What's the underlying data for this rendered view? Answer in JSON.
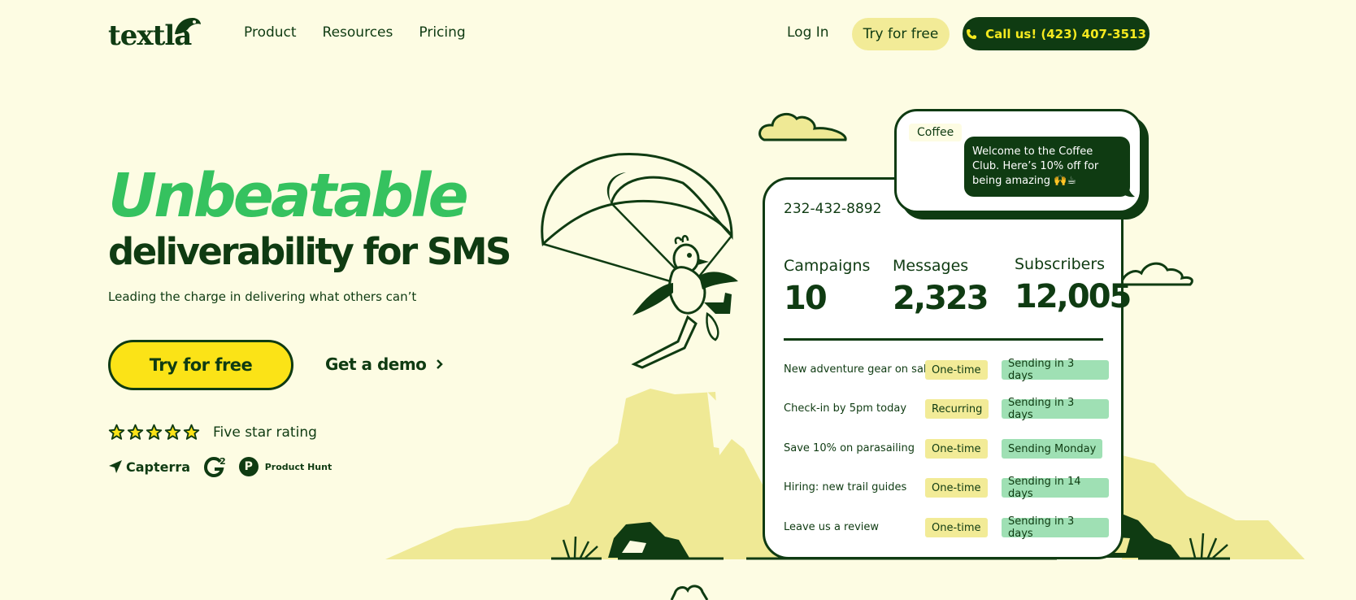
{
  "nav": {
    "logo_text": "textla",
    "links": [
      "Product",
      "Resources",
      "Pricing"
    ],
    "login": "Log In",
    "try_free": "Try for free",
    "call": "Call us! (423) 407-3513"
  },
  "hero": {
    "headline_1": "Unbeatable",
    "headline_2": "deliverability for SMS",
    "subtitle": "Leading the charge in delivering what others can’t",
    "cta_primary": "Try for free",
    "cta_secondary": "Get a demo",
    "rating_label": "Five star rating",
    "rating_stars": 5,
    "badges": {
      "capterra": "Capterra",
      "g2": "2",
      "producthunt_icon": "P",
      "producthunt": "Product Hunt"
    }
  },
  "message_card": {
    "sender": "Coffee",
    "message": "Welcome to the Coffee Club. Here’s 10% off for being amazing 🙌☕"
  },
  "dashboard": {
    "phone_number": "232-432-8892",
    "stats": [
      {
        "label": "Campaigns",
        "value": "10"
      },
      {
        "label": "Messages",
        "value": "2,323"
      },
      {
        "label": "Subscribers",
        "value": "12,005"
      }
    ],
    "campaigns": [
      {
        "name": "New adventure gear on sale",
        "type": "One-time",
        "status": "Sending in 3 days"
      },
      {
        "name": "Check-in by 5pm today",
        "type": "Recurring",
        "status": "Sending in 3 days"
      },
      {
        "name": "Save 10% on parasailing",
        "type": "One-time",
        "status": "Sending Monday"
      },
      {
        "name": "Hiring: new trail guides",
        "type": "One-time",
        "status": "Sending in 14 days"
      },
      {
        "name": "Leave us a review",
        "type": "One-time",
        "status": "Sending in 3 days"
      }
    ]
  },
  "colors": {
    "background": "#fdfce3",
    "dark_green": "#0f3b12",
    "bright_green": "#35c25f",
    "yellow": "#fbe317",
    "pale_yellow": "#f2eb97",
    "mint": "#9fe0b4"
  }
}
